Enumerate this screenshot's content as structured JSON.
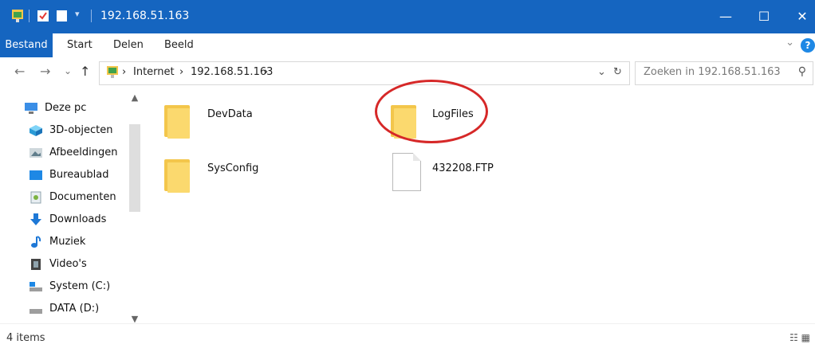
{
  "window": {
    "title": "192.168.51.163",
    "minimize": "—",
    "maximize": "☐",
    "close": "✕"
  },
  "ribbon": {
    "tabs": [
      "Bestand",
      "Start",
      "Delen",
      "Beeld"
    ],
    "expand": "⌄",
    "help": "?"
  },
  "nav": {
    "back": "←",
    "forward": "→",
    "recent": "⌄",
    "up": "↑",
    "crumbs": [
      "Internet",
      "192.168.51.163"
    ],
    "sep": "›",
    "dropdown": "⌄",
    "refresh": "↻"
  },
  "search": {
    "placeholder": "Zoeken in 192.168.51.163",
    "icon": "⚲"
  },
  "sidebar": {
    "items": [
      {
        "label": "Deze pc",
        "icon": "monitor-icon"
      },
      {
        "label": "3D-objecten",
        "icon": "cube-icon"
      },
      {
        "label": "Afbeeldingen",
        "icon": "pictures-icon"
      },
      {
        "label": "Bureaublad",
        "icon": "desktop-icon"
      },
      {
        "label": "Documenten",
        "icon": "documents-icon"
      },
      {
        "label": "Downloads",
        "icon": "download-arrow-icon"
      },
      {
        "label": "Muziek",
        "icon": "music-note-icon"
      },
      {
        "label": "Video's",
        "icon": "film-icon"
      },
      {
        "label": "System (C:)",
        "icon": "drive-icon"
      },
      {
        "label": "DATA (D:)",
        "icon": "drive-icon"
      }
    ],
    "scroll_up": "▲",
    "scroll_down": "▼"
  },
  "files": [
    {
      "name": "DevData",
      "type": "folder"
    },
    {
      "name": "LogFiles",
      "type": "folder"
    },
    {
      "name": "SysConfig",
      "type": "folder"
    },
    {
      "name": "432208.FTP",
      "type": "file"
    }
  ],
  "annotation": {
    "highlight_color": "#d62828"
  },
  "status": {
    "count": "4 items",
    "view_icons": "☷ ▦"
  },
  "colors": {
    "accent": "#1565c0",
    "folder": "#f3c64b"
  }
}
